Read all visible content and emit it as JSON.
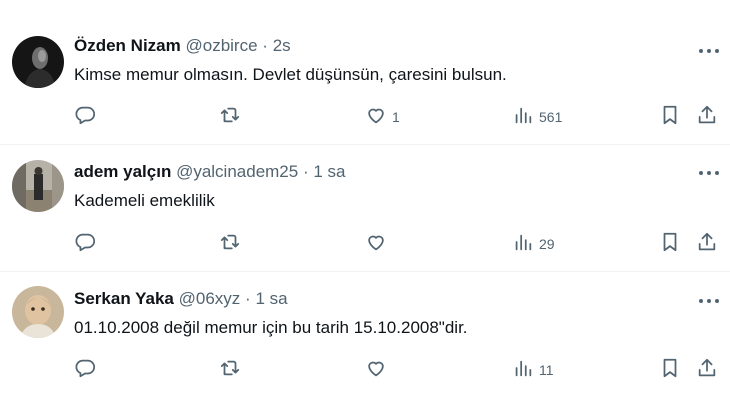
{
  "tweets": [
    {
      "name": "Özden Nizam",
      "handle": "@ozbirce",
      "sep": "·",
      "time": "2s",
      "text": "Kimse memur olmasın. Devlet düşünsün, çaresini bulsun.",
      "replies": "",
      "retweets": "",
      "likes": "1",
      "views": "561"
    },
    {
      "name": "adem yalçın",
      "handle": "@yalcinadem25",
      "sep": "·",
      "time": "1 sa",
      "text": "Kademeli emeklilik",
      "replies": "",
      "retweets": "",
      "likes": "",
      "views": "29"
    },
    {
      "name": "Serkan Yaka",
      "handle": "@06xyz",
      "sep": "·",
      "time": "1 sa",
      "text": "01.10.2008 değil memur için bu tarih 15.10.2008\"dir.",
      "replies": "",
      "retweets": "",
      "likes": "",
      "views": "11"
    }
  ],
  "icons": {
    "reply": "reply-icon",
    "retweet": "retweet-icon",
    "like": "heart-icon",
    "views": "views-icon",
    "bookmark": "bookmark-icon",
    "share": "share-icon",
    "more": "more-icon"
  },
  "colors": {
    "text": "#0f1419",
    "secondary": "#536471",
    "divider": "#eff3f4"
  }
}
